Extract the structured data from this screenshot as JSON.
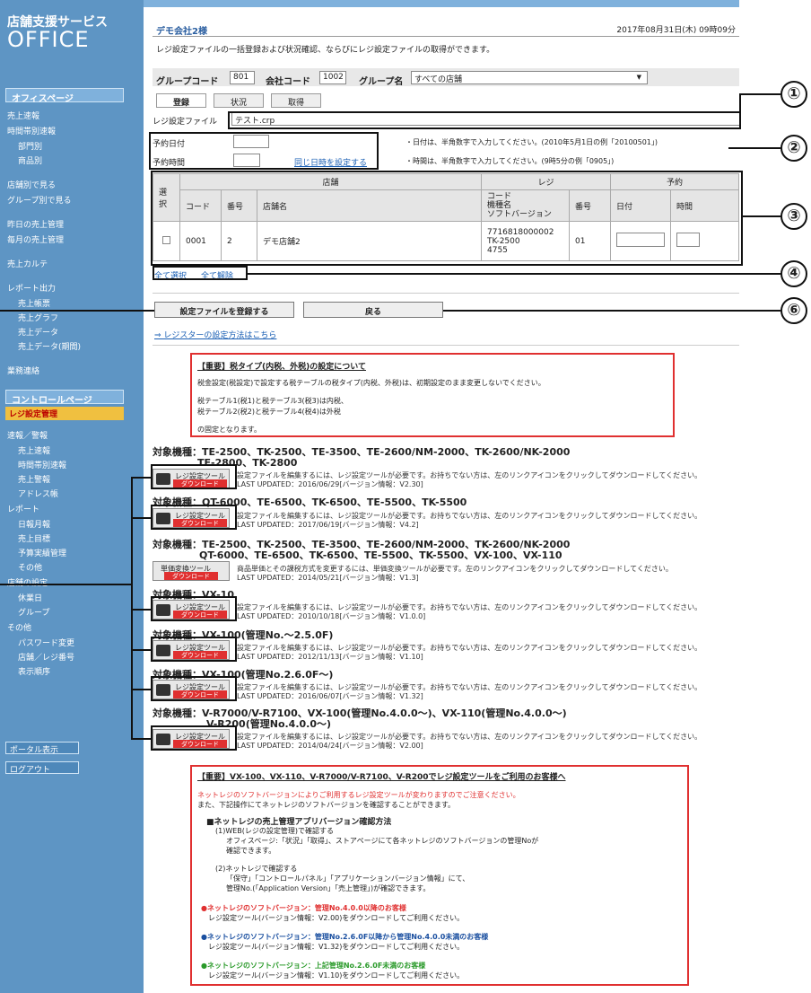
{
  "sidebar": {
    "brand_sub": "店舗支援サービス",
    "brand_main": "OFFICE",
    "section_office": "オフィスページ",
    "section_control": "コントロールページ",
    "items": [
      "売上速報",
      "時間帯別速報",
      "部門別",
      "商品別",
      "店舗別で見る",
      "グループ別で見る",
      "昨日の売上管理",
      "毎月の売上管理",
      "売上カルテ",
      "レポート出力",
      "売上帳票",
      "売上グラフ",
      "売上データ",
      "売上データ(期間)",
      "業務連絡"
    ],
    "control_items": [
      "レジ設定管理",
      "速報／警報",
      "売上速報",
      "時間帯別速報",
      "売上警報",
      "アドレス帳",
      "レポート",
      "日報月報",
      "売上目標",
      "予算実績管理",
      "その他",
      "店舗の設定",
      "休業日",
      "グループ",
      "その他",
      "パスワード変更",
      "店舗／レジ番号",
      "表示順序"
    ],
    "portal": "ポータル表示",
    "logout": "ログアウト"
  },
  "header": {
    "company": "デモ会社2様",
    "datetime": "2017年08月31日(木) 09時09分",
    "description": "レジ設定ファイルの一括登録および状況確認、ならびにレジ設定ファイルの取得ができます。"
  },
  "filters": {
    "group_code_label": "グループコード",
    "group_code": "801",
    "company_code_label": "会社コード",
    "company_code": "1002",
    "group_name_label": "グループ名",
    "group_name": "すべての店舗"
  },
  "tabs": [
    "登録",
    "状況",
    "取得"
  ],
  "file": {
    "label": "レジ設定ファイル",
    "value": "テスト.crp"
  },
  "schedule": {
    "date_label": "予約日付",
    "time_label": "予約時間",
    "same_datetime_link": "同じ日時を設定する",
    "date_hint": "・日付は、半角数字で入力してください。(2010年5月1日の例「20100501」)",
    "time_hint": "・時間は、半角数字で入力してください。(9時5分の例「0905」)"
  },
  "table": {
    "group_store": "店舗",
    "group_register": "レジ",
    "group_reserve": "予約",
    "col_select": "選択",
    "col_code": "コード",
    "col_number": "番号",
    "col_store_name": "店舗名",
    "col_reg_info": "コード\n機種名\nソフトバージョン",
    "col_reg_number": "番号",
    "col_date": "日付",
    "col_time": "時間",
    "rows": [
      {
        "code": "0001",
        "number": "2",
        "store_name": "デモ店舗2",
        "reg_info": "7716818000002\nTK-2500\n4755",
        "reg_number": "01"
      }
    ]
  },
  "select_links": {
    "select_all": "全て選択",
    "deselect_all": "全て解除"
  },
  "buttons": {
    "register": "設定ファイルを登録する",
    "back": "戻る"
  },
  "register_setup_link": "⇒ レジスターの設定方法はこちら",
  "notice1": {
    "title": "【重要】税タイプ(内税、外税)の設定について",
    "l1": "税金設定(税設定)で設定する税テーブルの税タイプ(内税、外税)は、初期設定のまま変更しないでください。",
    "l2": "税テーブル1(税1)と税テーブル3(税3)は内税、",
    "l3": "税テーブル2(税2)と税テーブル4(税4)は外税",
    "l4": "の固定となります。"
  },
  "downloads": {
    "models": [
      "対象機種：TE-2500、TK-2500、TE-3500、TE-2600/NM-2000、TK-2600/NK-2000",
      "TE-2800、TK-2800",
      "対象機種：QT-6000、TE-6500、TK-6500、TE-5500、TK-5500",
      "対象機種：TE-2500、TK-2500、TE-3500、TE-2600/NM-2000、TK-2600/NK-2000",
      "QT-6000、TE-6500、TK-6500、TE-5500、TK-5500、VX-100、VX-110",
      "対象機種：VX-10",
      "対象機種：VX-100(管理No.～2.5.0F)",
      "対象機種：VX-100(管理No.2.6.0F～)",
      "対象機種：V-R7000/V-R7100、VX-100(管理No.4.0.0～)、VX-110(管理No.4.0.0～)",
      "V-R200(管理No.4.0.0～)"
    ],
    "btn_label": "レジ設定ツール",
    "btn_label2": "単価変換ツール",
    "btn_sub": "ダウンロード",
    "desc": "設定ファイルを編集するには、レジ設定ツールが必要です。お持ちでない方は、左のリンクアイコンをクリックしてダウンロードしてください。",
    "desc2": "商品単価とその課税方式を変更するには、単価変換ツールが必要です。左のリンクアイコンをクリックしてダウンロードしてください。",
    "updates": [
      "LAST UPDATED：2016/06/29[バージョン情報：V2.30]",
      "LAST UPDATED：2017/06/19[バージョン情報：V4.2]",
      "LAST UPDATED：2014/05/21[バージョン情報：V1.3]",
      "LAST UPDATED：2010/10/18[バージョン情報：V1.0.0]",
      "LAST UPDATED：2012/11/13[バージョン情報：V1.10]",
      "LAST UPDATED：2016/06/07[バージョン情報：V1.32]",
      "LAST UPDATED：2014/04/24[バージョン情報：V2.00]"
    ]
  },
  "notice2": {
    "title": "【重要】VX-100、VX-110、V-R7000/V-R7100、V-R200でレジ設定ツールをご利用のお客様へ",
    "red1": "ネットレジのソフトバージョンによりご利用するレジ設定ツールが変わりますのでご注意ください。",
    "red2": "また、下記操作にてネットレジのソフトバージョンを確認することができます。",
    "h1": "■ネットレジの売上管理アプリバージョン確認方法",
    "s1a": "(1)WEB(レジの設定管理)で確認する",
    "s1b": "オフィスページ:「状況」「取得」、ストアページにて各ネットレジのソフトバージョンの管理Noが",
    "s1c": "確認できます。",
    "s2a": "(2)ネットレジで確認する",
    "s2b": "「保守」「コントロールパネル」「アプリケーションバージョン情報」にて、",
    "s2c": "管理No.(「Application Version」「売上管理」)が確認できます。",
    "b1": "●ネットレジのソフトバージョン：管理No.4.0.0以降のお客様",
    "b1s": "レジ設定ツール(バージョン情報：V2.00)をダウンロードしてご利用ください。",
    "b2": "●ネットレジのソフトバージョン：管理No.2.6.0F以降から管理No.4.0.0未満のお客様",
    "b2s": "レジ設定ツール(バージョン情報：V1.32)をダウンロードしてご利用ください。",
    "b3": "●ネットレジのソフトバージョン：上記管理No.2.6.0F未満のお客様",
    "b3s": "レジ設定ツール(バージョン情報：V1.10)をダウンロードしてご利用ください。"
  },
  "callouts": [
    "①",
    "②",
    "③",
    "④",
    "⑥"
  ],
  "colors": {
    "sidebar": "#5e95c4",
    "accent_red": "#e03030",
    "link_blue": "#1a5fb4",
    "green": "#2a9a2a"
  }
}
